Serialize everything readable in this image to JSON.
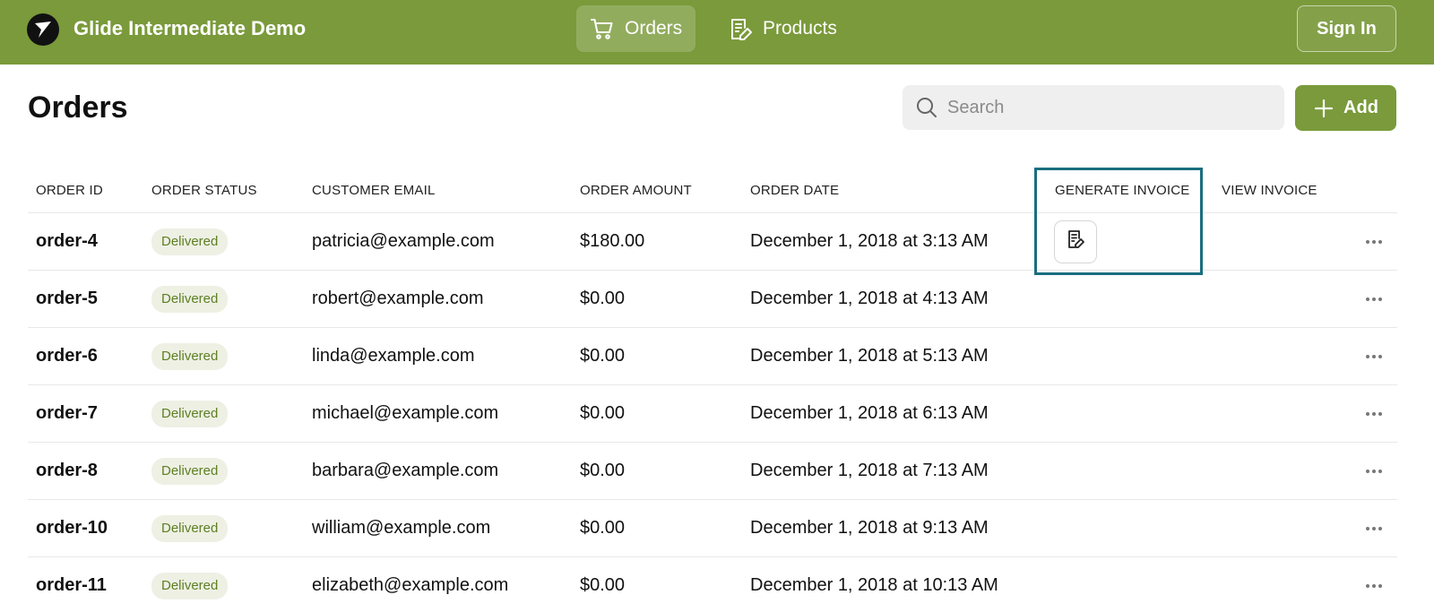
{
  "header": {
    "app_title": "Glide Intermediate Demo",
    "nav": [
      {
        "label": "Orders",
        "icon": "cart-icon",
        "active": true
      },
      {
        "label": "Products",
        "icon": "document-edit-icon",
        "active": false
      }
    ],
    "sign_in_label": "Sign In"
  },
  "page": {
    "title": "Orders",
    "search_placeholder": "Search",
    "add_label": "Add"
  },
  "table": {
    "columns": [
      "ORDER ID",
      "ORDER STATUS",
      "CUSTOMER EMAIL",
      "ORDER AMOUNT",
      "ORDER DATE",
      "GENERATE INVOICE",
      "VIEW INVOICE"
    ],
    "rows": [
      {
        "id": "order-4",
        "status": "Delivered",
        "email": "patricia@example.com",
        "amount": "$180.00",
        "date": "December 1, 2018 at 3:13 AM",
        "generate_invoice": true
      },
      {
        "id": "order-5",
        "status": "Delivered",
        "email": "robert@example.com",
        "amount": "$0.00",
        "date": "December 1, 2018 at 4:13 AM",
        "generate_invoice": false
      },
      {
        "id": "order-6",
        "status": "Delivered",
        "email": "linda@example.com",
        "amount": "$0.00",
        "date": "December 1, 2018 at 5:13 AM",
        "generate_invoice": false
      },
      {
        "id": "order-7",
        "status": "Delivered",
        "email": "michael@example.com",
        "amount": "$0.00",
        "date": "December 1, 2018 at 6:13 AM",
        "generate_invoice": false
      },
      {
        "id": "order-8",
        "status": "Delivered",
        "email": "barbara@example.com",
        "amount": "$0.00",
        "date": "December 1, 2018 at 7:13 AM",
        "generate_invoice": false
      },
      {
        "id": "order-10",
        "status": "Delivered",
        "email": "william@example.com",
        "amount": "$0.00",
        "date": "December 1, 2018 at 9:13 AM",
        "generate_invoice": false
      },
      {
        "id": "order-11",
        "status": "Delivered",
        "email": "elizabeth@example.com",
        "amount": "$0.00",
        "date": "December 1, 2018 at 10:13 AM",
        "generate_invoice": false
      }
    ]
  },
  "colors": {
    "brand": "#7a9a3b",
    "badge_bg": "#eef0e4",
    "badge_text": "#5d7f22",
    "highlight": "#1a6e80"
  }
}
